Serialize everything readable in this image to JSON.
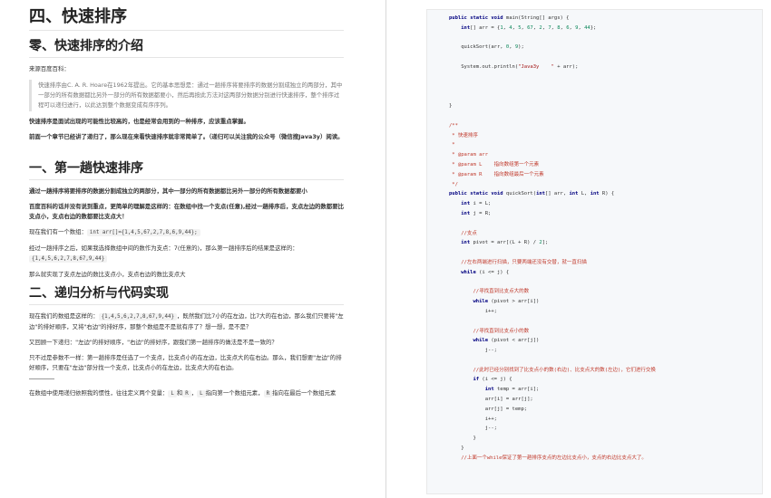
{
  "left": {
    "h1": "四、快速排序",
    "sec0_title": "零、快速排序的介绍",
    "source_label": "来源百度百科：",
    "quote": "快速排序由C. A. R. Hoare在1962年提出。它的基本思想是：通过一趟排序将要排序的数据分割成独立的两部分，其中一部分的所有数据都比另外一部分的所有数据都要小，然后再按此方法对这两部分数据分别进行快速排序，整个排序过程可以递归进行，以此达到整个数据变成有序序列。",
    "p_intro1": "快速排序是面试出现的可能性比较高的，也是经常会用到的一种排序，应该重点掌握。",
    "p_intro2": "前面一个章节已经讲了递归了，那么现在来看快速排序就非常简单了。（递归可以关注我的公众号（微信搜Java3y）阅读。",
    "sec1_title": "一、第一趟快速排序",
    "p_s1_1": "通过一趟排序将要排序的数据分割成独立的两部分，其中一部分的所有数据都比另外一部分的所有数据都要小",
    "p_s1_2": "百度百科的话并没有说到重点，更简单的理解是这样的：在数组中找一个支点(任意),经过一趟排序后，支点左边的数都要比支点小，支点右边的数都要比支点大！",
    "p_s1_3_pre": "现在我们有一个数组：",
    "p_s1_3_code": "int arr[]={1,4,5,67,2,7,8,6,9,44};",
    "p_s1_4_pre": "经过一趟排序之后，如果我选择数组中间的数作为支点：7(任意的)，那么第一趟排序后的结果是这样的：",
    "p_s1_4_code": "{1,4,5,6,2,7,8,67,9,44}",
    "p_s1_5": "那么就实现了支点左边的数比支点小，支点右边的数比支点大",
    "sec2_title": "二、递归分析与代码实现",
    "p_s2_1_pre": "现在我们的数组是这样的：",
    "p_s2_1_code": "{1,4,5,6,2,7,8,67,9,44}",
    "p_s2_1_post": "，既然我们比7小的在左边，比7大的在右边，那么我们只要将\"左边\"的排好顺序，又将\"右边\"的排好序，那整个数组是不是就有序了？想一想，是不是？",
    "p_s2_2": "又回顾一下递归：\"左边\"的排好顺序，\"右边\"的排好序，跟我们第一趟排序的做法是不是一致的？",
    "p_s2_3": "只不过是参数不一样：第一趟排序是任选了一个支点，比支点小的在左边，比支点大的在右边。那么，我们想要\"左边\"的排好顺序，只要在\"左边\"部分找一个支点，比支点小的在左边，比支点大的在右边。",
    "p_s2_4_a": "在数组中使用递归依照我的惯性，往往定义两个变量：",
    "p_s2_4_c1": "L",
    "p_s2_4_b": "和",
    "p_s2_4_c2": "R",
    "p_s2_4_c": "，",
    "p_s2_4_c3": "L",
    "p_s2_4_d": "指向第一个数组元素，",
    "p_s2_4_c4": "R",
    "p_s2_4_e": "指向在最后一个数组元素"
  },
  "code": {
    "lines": [
      "public static void main(String[] args) {",
      "    int[] arr = {1, 4, 5, 67, 2, 7, 8, 6, 9, 44};",
      "",
      "    quickSort(arr, 0, 9);",
      "",
      "    System.out.println(\"Java3y    \" + arr);",
      "",
      "",
      "",
      "}",
      "",
      "/**",
      " * 快速排序",
      " *",
      " * @param arr",
      " * @param L    指向数组第一个元素",
      " * @param R    指向数组最后一个元素",
      " */",
      "public static void quickSort(int[] arr, int L, int R) {",
      "    int i = L;",
      "    int j = R;",
      "",
      "    //支点",
      "    int pivot = arr[(L + R) / 2];",
      "",
      "    //左右两端进行扫描，只要两端还没有交替，就一直扫描",
      "    while (i <= j) {",
      "",
      "        //寻找直到比支点大的数",
      "        while (pivot > arr[i])",
      "            i++;",
      "",
      "        //寻找直到比支点小的数",
      "        while (pivot < arr[j])",
      "            j--;",
      "",
      "        //此时已经分别找到了比支点小的数(右边)、比支点大的数(左边)，它们进行交换",
      "        if (i <= j) {",
      "            int temp = arr[i];",
      "            arr[i] = arr[j];",
      "            arr[j] = temp;",
      "            i++;",
      "            j--;",
      "        }",
      "    }",
      "    //上面一个while保证了第一趟排序支点的左边比支点小，支点的右边比支点大了。"
    ]
  },
  "colors": {
    "keyword": "#000080",
    "string": "#a31515",
    "number": "#098658",
    "comment": "#c0392b",
    "code_bg": "#f6f8fa"
  }
}
